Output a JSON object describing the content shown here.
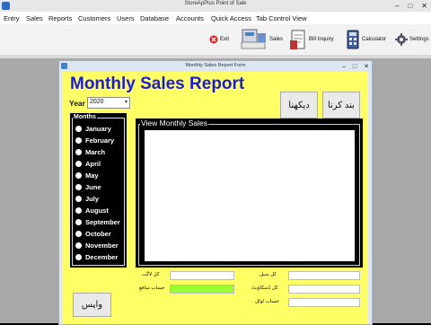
{
  "app": {
    "title": "StoreApPlus Point of Sale",
    "window_buttons": [
      "–",
      "□",
      "✕"
    ]
  },
  "menu": [
    "Entry",
    "Sales",
    "Reports",
    "Customers",
    "Users",
    "Database",
    "Accounts",
    "Quick Access",
    "Tab Control View"
  ],
  "ribbon": {
    "exit": "Exit",
    "sales": "Sales",
    "bill_inquiry": "Bill Inquiry",
    "calculator": "Calculator",
    "settings": "Settings"
  },
  "form": {
    "title": "Monthly Sales Report Form",
    "window_buttons": [
      "–",
      "□",
      "✕"
    ],
    "heading": "Monthly Sales Report",
    "year_label": "Year",
    "year_value": "2020",
    "close_button": "بند کرنا",
    "view_button": "دیکھنا",
    "back_button": "واپس",
    "months_legend": "Months",
    "months": [
      "January",
      "February",
      "March",
      "April",
      "May",
      "June",
      "July",
      "August",
      "September",
      "October",
      "November",
      "December"
    ],
    "view_legend": "View Monthly Sales",
    "fields": {
      "total_cost": "کل لاگت",
      "total_profit": "حساب منافع",
      "total_sale": "کل سیل",
      "total_discount": "کل ڈسکاؤنٹ",
      "total_account": "حساب ٹوٹل"
    }
  },
  "colors": {
    "form_background": "#ffff66",
    "heading": "#1a1ae0",
    "panel": "#000000",
    "profit_field": "#99ff33"
  }
}
